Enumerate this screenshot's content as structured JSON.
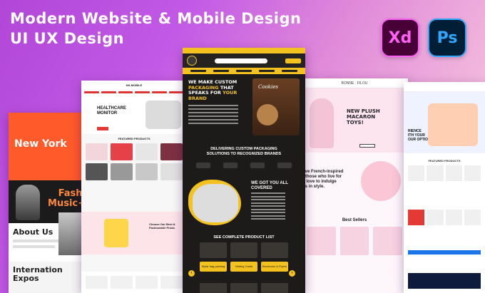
{
  "headline": {
    "line1": "Modern Website & Mobile Design",
    "line2": "UI UX Design"
  },
  "badges": {
    "xd": "Xd",
    "ps": "Ps"
  },
  "mockups": {
    "fashion": {
      "hero_title": "New York",
      "music": "Fashi\nMusic+",
      "about": "About Us",
      "intl": "Internation\nExpos"
    },
    "healthcare": {
      "brand": "HH-MOBILE",
      "hero": "HEALTHCARE\nMONITOR",
      "featured": "FEATURED PRODUCTS",
      "choose": "Choose Our Best &\nFashionable Produ"
    },
    "packaging": {
      "hero_a": "WE MAKE CUSTOM",
      "hero_b": "PACKAGING",
      "hero_c": "THAT",
      "hero_d": "SPEAKS FOR",
      "hero_e": "YOUR",
      "hero_f": "BRAND",
      "box_label": "Cookies",
      "delivering": "DELIVERING CUSTOM PACKAGING\nSOLUTIONS TO RECOGNIZED BRANDS",
      "wegot": "WE GOT YOU ALL\nCOVERED",
      "see_complete": "SEE COMPLETE PRODUCT LIST",
      "cat1": "Mylar bag packing",
      "cat2": "Visiting Cards",
      "cat3": "Brochures & Flyers",
      "arrow_left": "‹",
      "arrow_right": "›"
    },
    "toys": {
      "brand": "BONNE · FILOU",
      "hero": "NEW PLUSH\nMACARON\nTOYS!",
      "btn": "SHOP NOW",
      "mid": "tive French-inspired\nr those who live for\nd love to indulge\ngs in style.",
      "best": "Best Sellers"
    },
    "electronics": {
      "hero": "RIENCE\nITH YOUR\nOUR OPTIONS",
      "featured": "FEATURED PRODUCTS"
    }
  },
  "colors": {
    "bg_start": "#b146d8",
    "bg_end": "#f6c9e4",
    "accent_yellow": "#f3c21f",
    "accent_orange": "#ff5a2a"
  }
}
